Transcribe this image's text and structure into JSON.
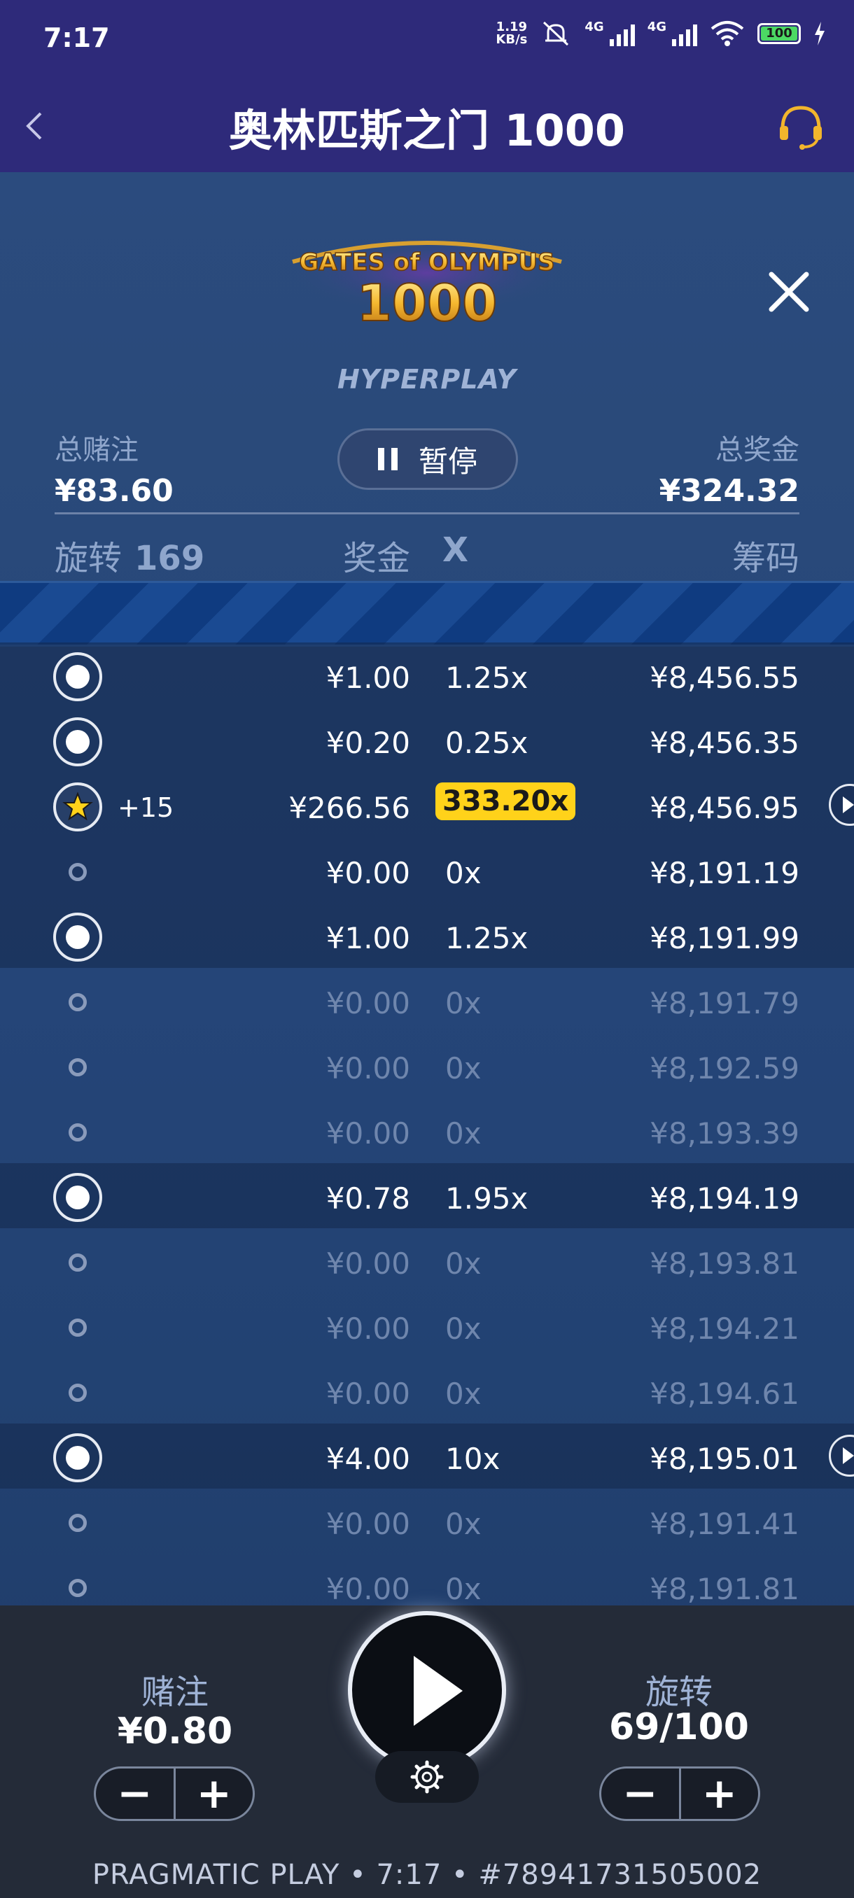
{
  "status_bar": {
    "time": "7:17",
    "net_speed": "1.19",
    "net_speed_unit": "KB/s",
    "network_1": "4G",
    "network_2": "4G",
    "battery": "100"
  },
  "header": {
    "title": "奥林匹斯之门 1000"
  },
  "game": {
    "logo_line1": "GATES of OLYMPUS",
    "logo_line2": "1000",
    "hyperplay": "HYPERPLAY",
    "total_bet_label": "总赌注",
    "total_bet_value": "¥83.60",
    "total_win_label": "总奖金",
    "total_win_value": "¥324.32",
    "pause_label": "暂停",
    "columns": {
      "spin_label": "旋转",
      "spin_count": "169",
      "win": "奖金",
      "mult": "X",
      "chips": "筹码"
    }
  },
  "rows": [
    {
      "type": "big",
      "extra": "",
      "win": "¥1.00",
      "mult": "1.25x",
      "chips": "¥8,456.55",
      "dim": false,
      "hl": true,
      "arrow": false,
      "badge": false
    },
    {
      "type": "big",
      "extra": "",
      "win": "¥0.20",
      "mult": "0.25x",
      "chips": "¥8,456.35",
      "dim": false,
      "hl": true,
      "arrow": false,
      "badge": false
    },
    {
      "type": "star",
      "extra": "+15",
      "win": "¥266.56",
      "mult": "333.20x",
      "chips": "¥8,456.95",
      "dim": false,
      "hl": true,
      "arrow": true,
      "badge": true
    },
    {
      "type": "small",
      "extra": "",
      "win": "¥0.00",
      "mult": "0x",
      "chips": "¥8,191.19",
      "dim": false,
      "hl": true,
      "arrow": false,
      "badge": false
    },
    {
      "type": "big",
      "extra": "",
      "win": "¥1.00",
      "mult": "1.25x",
      "chips": "¥8,191.99",
      "dim": false,
      "hl": true,
      "arrow": false,
      "badge": false
    },
    {
      "type": "small",
      "extra": "",
      "win": "¥0.00",
      "mult": "0x",
      "chips": "¥8,191.79",
      "dim": true,
      "hl": false,
      "arrow": false,
      "badge": false
    },
    {
      "type": "small",
      "extra": "",
      "win": "¥0.00",
      "mult": "0x",
      "chips": "¥8,192.59",
      "dim": true,
      "hl": false,
      "arrow": false,
      "badge": false
    },
    {
      "type": "small",
      "extra": "",
      "win": "¥0.00",
      "mult": "0x",
      "chips": "¥8,193.39",
      "dim": true,
      "hl": false,
      "arrow": false,
      "badge": false
    },
    {
      "type": "big",
      "extra": "",
      "win": "¥0.78",
      "mult": "1.95x",
      "chips": "¥8,194.19",
      "dim": false,
      "hl": true,
      "arrow": false,
      "badge": false
    },
    {
      "type": "small",
      "extra": "",
      "win": "¥0.00",
      "mult": "0x",
      "chips": "¥8,193.81",
      "dim": true,
      "hl": false,
      "arrow": false,
      "badge": false
    },
    {
      "type": "small",
      "extra": "",
      "win": "¥0.00",
      "mult": "0x",
      "chips": "¥8,194.21",
      "dim": true,
      "hl": false,
      "arrow": false,
      "badge": false
    },
    {
      "type": "small",
      "extra": "",
      "win": "¥0.00",
      "mult": "0x",
      "chips": "¥8,194.61",
      "dim": true,
      "hl": false,
      "arrow": false,
      "badge": false
    },
    {
      "type": "big",
      "extra": "",
      "win": "¥4.00",
      "mult": "10x",
      "chips": "¥8,195.01",
      "dim": false,
      "hl": true,
      "arrow": true,
      "badge": false
    },
    {
      "type": "small",
      "extra": "",
      "win": "¥0.00",
      "mult": "0x",
      "chips": "¥8,191.41",
      "dim": true,
      "hl": false,
      "arrow": false,
      "badge": false
    },
    {
      "type": "small",
      "extra": "",
      "win": "¥0.00",
      "mult": "0x",
      "chips": "¥8,191.81",
      "dim": true,
      "hl": false,
      "arrow": false,
      "badge": false
    }
  ],
  "controls": {
    "bet_label": "赌注",
    "bet_value": "¥0.80",
    "spins_label": "旋转",
    "spins_value": "69/100",
    "minus": "−",
    "plus": "+"
  },
  "footer": {
    "text": "PRAGMATIC PLAY • 7:17 • #78941731505002"
  },
  "colors": {
    "header_bg": "#2e2a7a",
    "panel_bg": "#2a4a7a",
    "badge_yellow": "#ffd21a",
    "controls_bg": "#242b38"
  }
}
